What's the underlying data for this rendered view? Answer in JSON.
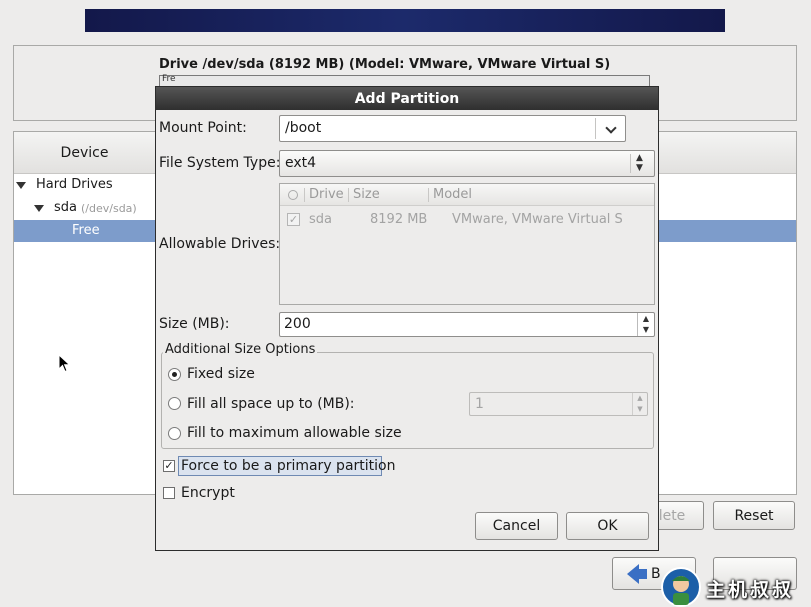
{
  "installer": {
    "drive_title": "Drive /dev/sda (8192 MB) (Model: VMware, VMware Virtual S)",
    "drive_bar_text": "Fre",
    "device_column_header": "Device",
    "tree": {
      "hard_drives_label": "Hard Drives",
      "sda_label": "sda",
      "sda_path": "(/dev/sda)",
      "free_label": "Free"
    },
    "buttons": {
      "delete_label": "lete",
      "reset_label": "Reset",
      "back_label": "B",
      "next_label": ""
    }
  },
  "dialog": {
    "title": "Add Partition",
    "mount_point": {
      "label": "Mount Point:",
      "value": "/boot"
    },
    "file_system_type": {
      "label": "File System Type:",
      "value": "ext4"
    },
    "allowable_drives": {
      "label": "Allowable Drives:",
      "columns": [
        "Drive",
        "Size",
        "Model"
      ],
      "rows": [
        {
          "checked": true,
          "drive": "sda",
          "size": "8192 MB",
          "model": "VMware, VMware Virtual S"
        }
      ]
    },
    "size": {
      "label": "Size (MB):",
      "value": "200"
    },
    "additional_size_options": {
      "title": "Additional Size Options",
      "selected": "fixed",
      "fixed_label": "Fixed size",
      "fill_up_label": "Fill all space up to (MB):",
      "fill_up_value": "1",
      "fill_max_label": "Fill to maximum allowable size"
    },
    "force_primary": {
      "label": "Force to be a primary partition",
      "checked": true
    },
    "encrypt": {
      "label": "Encrypt",
      "checked": false
    },
    "cancel_label": "Cancel",
    "ok_label": "OK"
  },
  "watermark": {
    "text": "主机叔叔"
  },
  "colors": {
    "selection": "#7d9ccb",
    "titlebar": "#3a3a3a",
    "banner": "#1a2260",
    "background": "#edeceb"
  }
}
